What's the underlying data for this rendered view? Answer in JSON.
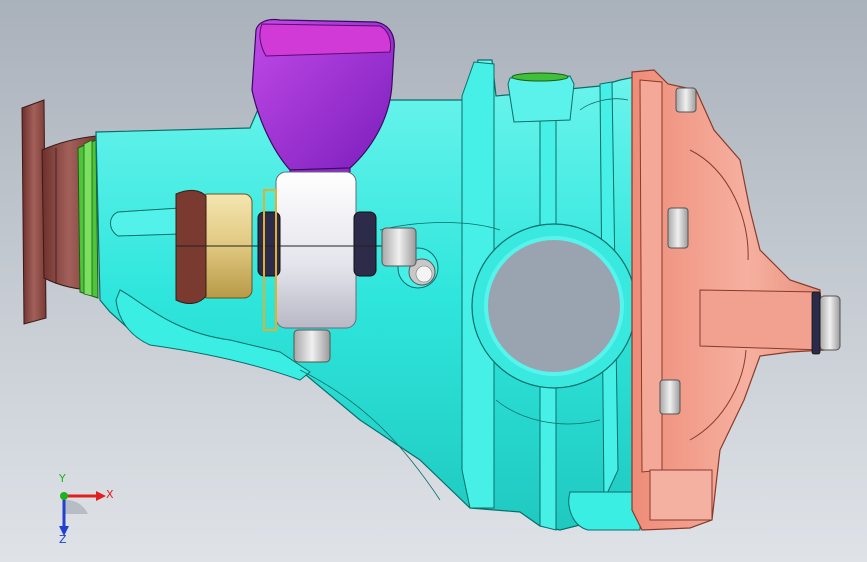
{
  "viewport": {
    "background_top": "#a9b1bb",
    "background_bottom": "#dfe3e8"
  },
  "model": {
    "parts": [
      {
        "name": "input-flange",
        "color": "#8b4a45"
      },
      {
        "name": "seal-ring",
        "color": "#5ac43a"
      },
      {
        "name": "housing",
        "color": "#2fe6dc"
      },
      {
        "name": "mount-bracket",
        "color": "#9b2fd6"
      },
      {
        "name": "mount-top",
        "color": "#d23fd2"
      },
      {
        "name": "rubber-bushing",
        "color": "#e8e8ee"
      },
      {
        "name": "bearing-sleeve",
        "color": "#e3cf8a"
      },
      {
        "name": "carrier-cover",
        "color": "#f2a28f"
      },
      {
        "name": "bolts",
        "color": "#d8d8d8"
      }
    ]
  },
  "triad": {
    "x_label": "X",
    "y_label": "Y",
    "z_label": "Z",
    "x_color": "#e02020",
    "y_color": "#20b020",
    "z_color": "#2040d0"
  }
}
